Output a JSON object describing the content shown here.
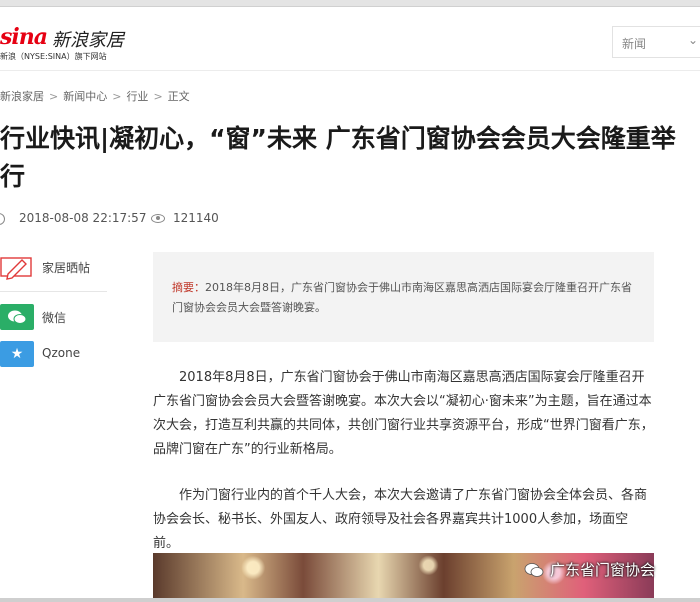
{
  "header": {
    "logo_sina": "sina",
    "logo_name": "新浪家居",
    "logo_sub": "新浪（NYSE:SINA）旗下网站",
    "nav_select_label": "新闻",
    "nav_select_icon": "chevron-down-icon"
  },
  "breadcrumb": [
    "新浪家居",
    "新闻中心",
    "行业",
    "正文"
  ],
  "article": {
    "title": "行业快讯|凝初心，“窗”未来 广东省门窗协会会员大会隆重举行",
    "date": "2018-08-08 22:17:57",
    "views": "121140",
    "summary_lead": "摘要：",
    "summary_text": "2018年8月8日，广东省门窗协会于佛山市南海区嘉思高洒店国际宴会厅隆重召开广东省门窗协会会员大会暨答谢晚宴。",
    "paragraphs": [
      "2018年8月8日，广东省门窗协会于佛山市南海区嘉思高洒店国际宴会厅隆重召开广东省门窗协会会员大会暨答谢晚宴。本次大会以“凝初心·窗未来”为主题，旨在通过本次大会，打造互利共赢的共同体，共创门窗行业共享资源平台，形成“世界门窗看广东，品牌门窗在广东”的行业新格局。",
      "作为门窗行业内的首个千人大会，本次大会邀请了广东省门窗协会全体会员、各商协会会长、秘书长、外国友人、政府领导及社会各界嘉宾共计1000人参加，场面空前。"
    ]
  },
  "share": {
    "items": [
      {
        "label": "家居晒帖",
        "icon": "pencil-icon"
      },
      {
        "label": "微信",
        "icon": "wechat-icon",
        "color": "#2aae67"
      },
      {
        "label": "Qzone",
        "icon": "qzone-star-icon",
        "color": "#3b9ce3"
      }
    ]
  },
  "watermark": {
    "text": "广东省门窗协会",
    "icon": "wechat-icon"
  },
  "colors": {
    "brand_red": "#e60012",
    "summary_bg": "#f3f3f3",
    "summary_lead": "#c0392b"
  }
}
